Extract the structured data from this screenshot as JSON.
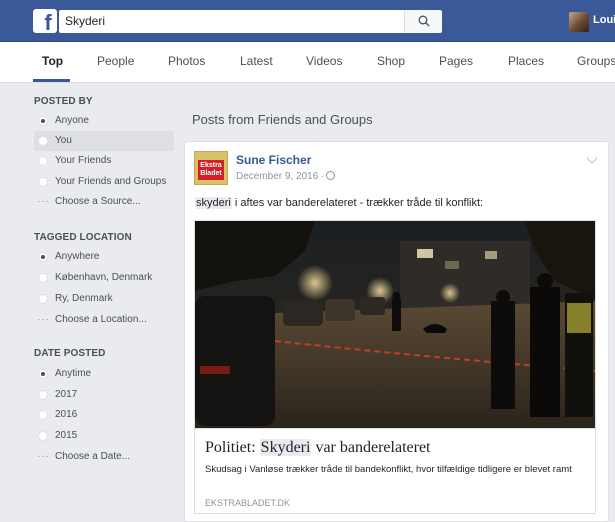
{
  "search": {
    "query": "Skyderi"
  },
  "header": {
    "user_name": "Loui"
  },
  "tabs": [
    {
      "label": "Top"
    },
    {
      "label": "People"
    },
    {
      "label": "Photos"
    },
    {
      "label": "Latest"
    },
    {
      "label": "Videos"
    },
    {
      "label": "Shop"
    },
    {
      "label": "Pages"
    },
    {
      "label": "Places"
    },
    {
      "label": "Groups"
    }
  ],
  "filters": {
    "posted_by": {
      "title": "POSTED BY",
      "options": [
        "Anyone",
        "You",
        "Your Friends",
        "Your Friends and Groups"
      ],
      "more": "Choose a Source..."
    },
    "tagged_location": {
      "title": "TAGGED LOCATION",
      "options": [
        "Anywhere",
        "København, Denmark",
        "Ry, Denmark"
      ],
      "more": "Choose a Location..."
    },
    "date_posted": {
      "title": "DATE POSTED",
      "options": [
        "Anytime",
        "2017",
        "2016",
        "2015"
      ],
      "more": "Choose a Date..."
    }
  },
  "results": {
    "section_title": "Posts from Friends and Groups",
    "post": {
      "author": "Sune Fischer",
      "date": "December 9, 2016 ·",
      "logo_text": "Ekstra Bladet",
      "text_highlight": "skyderi",
      "text_rest": " i aftes var banderelateret - trækker tråde til konflikt:",
      "link": {
        "title_prefix": "Politiet: ",
        "title_highlight": "Skyderi",
        "title_suffix": " var banderelateret",
        "description": "Skudsag i Vanløse trækker tråde til bandekonflikt, hvor tilfældige tidligere er blevet ramt",
        "domain": "EKSTRABLADET.DK"
      }
    }
  },
  "colors": {
    "brand": "#3b5998",
    "link": "#365899",
    "background": "#e9ebee"
  },
  "icons": {
    "logo": "facebook-logo-icon",
    "search": "search-icon",
    "globe": "globe-icon",
    "chevron": "chevron-down-icon"
  }
}
